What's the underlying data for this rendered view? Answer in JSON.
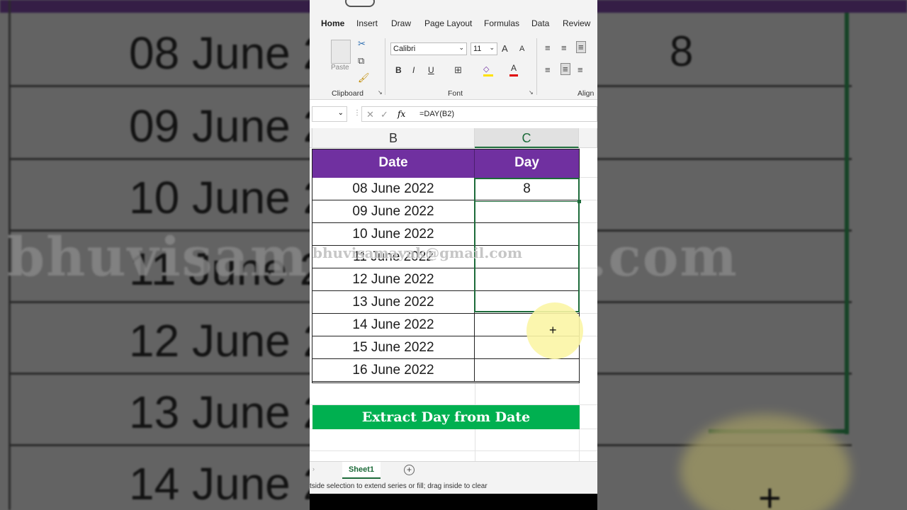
{
  "background": {
    "dates": [
      "08 June 2",
      "09 June 2",
      "10 June 2",
      "11 June 2",
      "12 June 2",
      "13 June 2",
      "14 June 2"
    ],
    "day_value": "8",
    "watermark": "bhuvisamay",
    "watermark_right": ".com"
  },
  "ribbon": {
    "tabs": [
      "Home",
      "Insert",
      "Draw",
      "Page Layout",
      "Formulas",
      "Data",
      "Review"
    ],
    "active_tab": "Home",
    "paste_label": "Paste",
    "font_name": "Calibri",
    "font_size": "11",
    "bold": "B",
    "italic": "I",
    "underline": "U",
    "grow_font": "A",
    "shrink_font": "A",
    "groups": [
      "Clipboard",
      "Font",
      "Align"
    ]
  },
  "formula_bar": {
    "formula": "=DAY(B2)",
    "fx": "fx"
  },
  "sheet": {
    "col_b": "B",
    "col_c": "C",
    "header_date": "Date",
    "header_day": "Day",
    "dates": [
      "08 June 2022",
      "09 June 2022",
      "10 June 2022",
      "11 June 2022",
      "12 June 2022",
      "13 June 2022",
      "14 June 2022",
      "15 June 2022",
      "16 June 2022"
    ],
    "days": [
      "8",
      "",
      "",
      "",
      "",
      "",
      "",
      "",
      ""
    ],
    "banner": "Extract Day from Date",
    "watermark": "bhuvisamayak@gmail.com",
    "cursor": "+"
  },
  "sheet_tabs": {
    "active": "Sheet1",
    "add": "+"
  },
  "status": {
    "text": "tside selection to extend series or fill; drag inside to clear"
  },
  "colors": {
    "header_purple": "#7030a0",
    "banner_green": "#00b050",
    "excel_green": "#1d6b3a"
  }
}
